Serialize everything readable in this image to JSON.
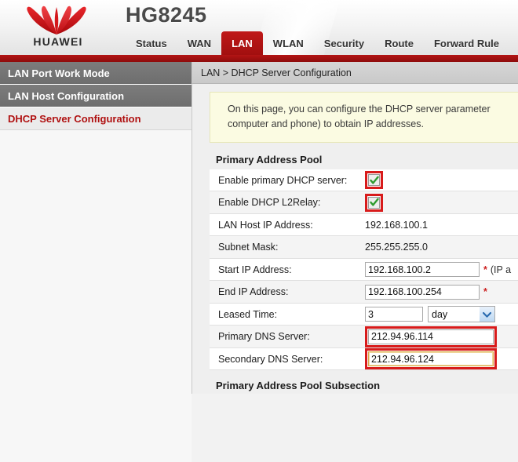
{
  "header": {
    "brand": "HUAWEI",
    "logo_icon": "huawei-flower-logo",
    "model": "HG8245"
  },
  "nav": {
    "items": [
      {
        "label": "Status",
        "active": false
      },
      {
        "label": "WAN",
        "active": false
      },
      {
        "label": "LAN",
        "active": true
      },
      {
        "label": "WLAN",
        "active": false
      },
      {
        "label": "Security",
        "active": false
      },
      {
        "label": "Route",
        "active": false
      },
      {
        "label": "Forward Rule",
        "active": false
      }
    ]
  },
  "sidebar": {
    "items": [
      {
        "label": "LAN Port Work Mode",
        "state": "normal"
      },
      {
        "label": "LAN Host Configuration",
        "state": "normal"
      },
      {
        "label": "DHCP Server Configuration",
        "state": "current"
      }
    ]
  },
  "main": {
    "breadcrumb": "LAN > DHCP Server Configuration",
    "notice_line1": "On this page, you can configure the DHCP server parameter",
    "notice_line2": "computer and phone) to obtain IP addresses.",
    "section_title": "Primary Address Pool",
    "subsection_title": "Primary Address Pool Subsection",
    "rows": [
      {
        "label": "Enable primary DHCP server:",
        "type": "checkbox",
        "checked": true,
        "annotated": true
      },
      {
        "label": "Enable DHCP L2Relay:",
        "type": "checkbox",
        "checked": true,
        "annotated": true
      },
      {
        "label": "LAN Host IP Address:",
        "type": "text-static",
        "value": "192.168.100.1"
      },
      {
        "label": "Subnet Mask:",
        "type": "text-static",
        "value": "255.255.255.0"
      },
      {
        "label": "Start IP Address:",
        "type": "input",
        "value": "192.168.100.2",
        "required_mark": "*",
        "hint": "(IP a"
      },
      {
        "label": "End IP Address:",
        "type": "input",
        "value": "192.168.100.254",
        "required_mark": "*",
        "hint": ""
      },
      {
        "label": "Leased Time:",
        "type": "input-select",
        "value": "3",
        "select_value": "day",
        "select_icon": "chevron-down-icon"
      },
      {
        "label": "Primary DNS Server:",
        "type": "input",
        "value": "212.94.96.114",
        "annotated": true
      },
      {
        "label": "Secondary DNS Server:",
        "type": "input",
        "value": "212.94.96.124",
        "annotated": true,
        "focused": true
      }
    ]
  },
  "colors": {
    "brand_red": "#b01111",
    "nav_active": "#a20f0f",
    "annotation_red": "#d81b1b",
    "check_green": "#2f9b2f",
    "notice_bg": "#fbfbe2"
  }
}
